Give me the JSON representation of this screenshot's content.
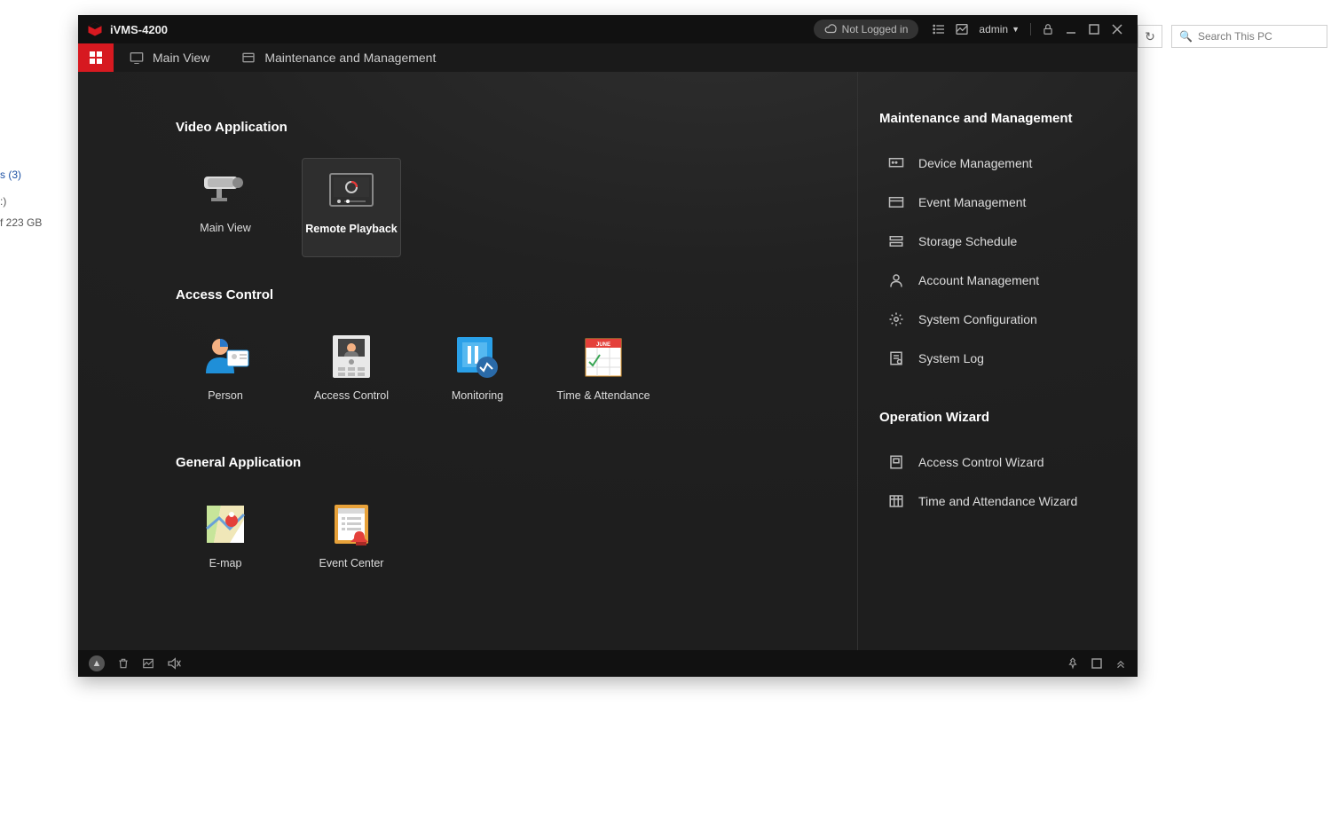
{
  "explorer": {
    "search_placeholder": "Search This PC",
    "side_link": "s (3)",
    "side_colon": ":)",
    "side_free": "f 223 GB"
  },
  "app_title": "iVMS-4200",
  "titlebar": {
    "not_logged": "Not Logged in",
    "user": "admin"
  },
  "tabs": {
    "main_view": "Main View",
    "maint": "Maintenance and Management"
  },
  "sections": {
    "video": "Video Application",
    "access": "Access Control",
    "general": "General Application"
  },
  "tiles": {
    "main_view": "Main View",
    "remote_playback": "Remote Playback",
    "person": "Person",
    "access_control": "Access Control",
    "monitoring": "Monitoring",
    "time_attendance": "Time & Attendance",
    "emap": "E-map",
    "event_center": "Event Center"
  },
  "right": {
    "maint_heading": "Maintenance and Management",
    "device_mgmt": "Device Management",
    "event_mgmt": "Event Management",
    "storage_schedule": "Storage Schedule",
    "account_mgmt": "Account Management",
    "sys_config": "System Configuration",
    "sys_log": "System Log",
    "op_wizard_heading": "Operation Wizard",
    "ac_wizard": "Access Control Wizard",
    "ta_wizard": "Time and Attendance Wizard"
  },
  "calendar_month": "JUNE"
}
